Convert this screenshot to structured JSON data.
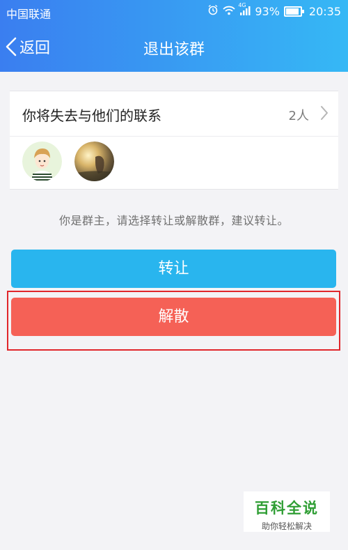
{
  "status_bar": {
    "carrier": "中国联通",
    "network": "4G",
    "battery": "93%",
    "time": "20:35"
  },
  "nav": {
    "back_label": "返回",
    "title": "退出该群"
  },
  "members_card": {
    "title": "你将失去与他们的联系",
    "count": "2人",
    "avatars": [
      "cartoon-boy-avatar",
      "sunset-photo-avatar"
    ]
  },
  "hint": "你是群主，请选择转让或解散群，建议转让。",
  "buttons": {
    "transfer": "转让",
    "dissolve": "解散"
  },
  "colors": {
    "header_gradient_start": "#3a7ef0",
    "header_gradient_end": "#36b8f5",
    "transfer_button": "#29b5ee",
    "dissolve_button": "#f56156",
    "highlight_border": "#e1262b",
    "watermark_green": "#2f9e34"
  },
  "watermark": {
    "title": "百科全说",
    "subtitle": "助你轻松解决"
  }
}
